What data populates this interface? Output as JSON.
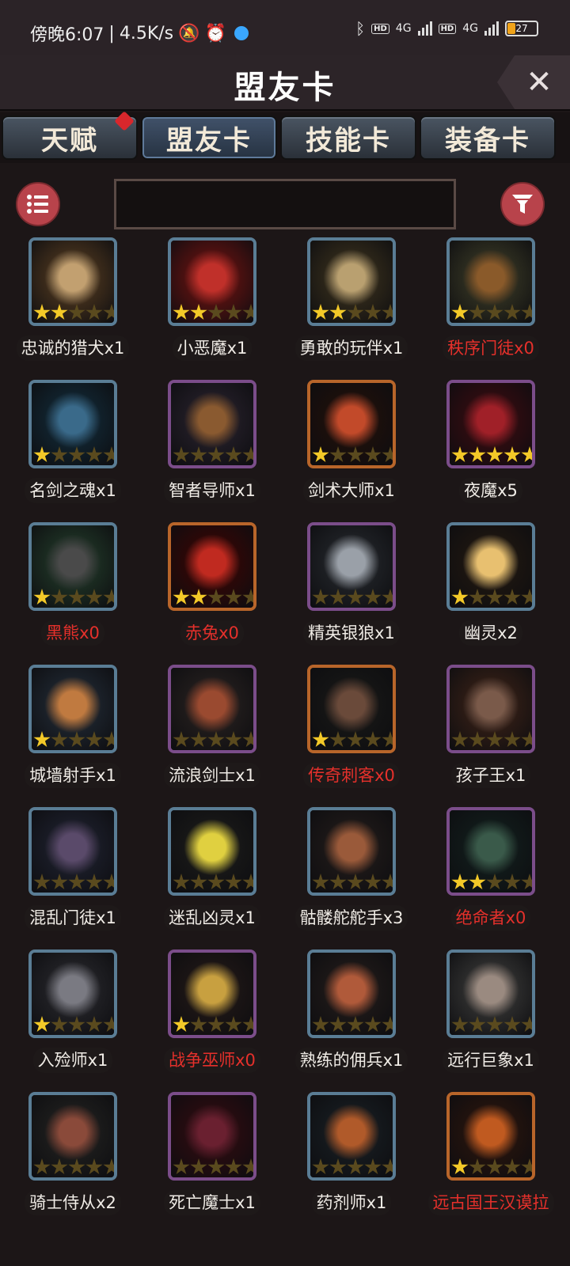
{
  "status_bar": {
    "time": "傍晚6:07",
    "speed": "4.5K/s",
    "network_1": "4G",
    "network_2": "4G",
    "hd_1": "HD",
    "hd_2": "HD",
    "battery": "27"
  },
  "header": {
    "title": "盟友卡",
    "close_label": "✕"
  },
  "tabs": [
    {
      "label": "天赋",
      "badge": true
    },
    {
      "label": "盟友卡",
      "active": true
    },
    {
      "label": "技能卡"
    },
    {
      "label": "装备卡"
    }
  ],
  "search": {
    "value": ""
  },
  "icons": {
    "menu": "list-icon",
    "filter": "filter-icon",
    "close": "close-icon"
  },
  "cards": [
    {
      "name": "忠诚的猎犬x1",
      "stars": 2,
      "owned": true,
      "frame": "blue"
    },
    {
      "name": "小恶魔x1",
      "stars": 2,
      "owned": true,
      "frame": "blue"
    },
    {
      "name": "勇敢的玩伴x1",
      "stars": 2,
      "owned": true,
      "frame": "blue"
    },
    {
      "name": "秩序门徒x0",
      "stars": 1,
      "owned": false,
      "frame": "blue"
    },
    {
      "name": "名剑之魂x1",
      "stars": 1,
      "owned": true,
      "frame": "blue"
    },
    {
      "name": "智者导师x1",
      "stars": 0,
      "owned": true,
      "frame": "purple"
    },
    {
      "name": "剑术大师x1",
      "stars": 1,
      "owned": true,
      "frame": "orange"
    },
    {
      "name": "夜魔x5",
      "stars": 5,
      "owned": true,
      "frame": "purple"
    },
    {
      "name": "黑熊x0",
      "stars": 1,
      "owned": false,
      "frame": "blue"
    },
    {
      "name": "赤兔x0",
      "stars": 2,
      "owned": false,
      "frame": "orange"
    },
    {
      "name": "精英银狼x1",
      "stars": 0,
      "owned": true,
      "frame": "purple"
    },
    {
      "name": "幽灵x2",
      "stars": 1,
      "owned": true,
      "frame": "blue"
    },
    {
      "name": "城墙射手x1",
      "stars": 1,
      "owned": true,
      "frame": "blue"
    },
    {
      "name": "流浪剑士x1",
      "stars": 0,
      "owned": true,
      "frame": "purple"
    },
    {
      "name": "传奇刺客x0",
      "stars": 1,
      "owned": false,
      "frame": "orange"
    },
    {
      "name": "孩子王x1",
      "stars": 0,
      "owned": true,
      "frame": "purple"
    },
    {
      "name": "混乱门徒x1",
      "stars": 0,
      "owned": true,
      "frame": "blue"
    },
    {
      "name": "迷乱凶灵x1",
      "stars": 0,
      "owned": true,
      "frame": "blue"
    },
    {
      "name": "骷髅舵舵手x3",
      "stars": 0,
      "owned": true,
      "frame": "blue"
    },
    {
      "name": "绝命者x0",
      "stars": 2,
      "owned": false,
      "frame": "purple"
    },
    {
      "name": "入殓师x1",
      "stars": 1,
      "owned": true,
      "frame": "blue"
    },
    {
      "name": "战争巫师x0",
      "stars": 1,
      "owned": false,
      "frame": "purple"
    },
    {
      "name": "熟练的佣兵x1",
      "stars": 0,
      "owned": true,
      "frame": "blue"
    },
    {
      "name": "远行巨象x1",
      "stars": 0,
      "owned": true,
      "frame": "blue"
    },
    {
      "name": "骑士侍从x2",
      "stars": 0,
      "owned": true,
      "frame": "blue"
    },
    {
      "name": "死亡魔士x1",
      "stars": 0,
      "owned": true,
      "frame": "purple"
    },
    {
      "name": "药剂师x1",
      "stars": 0,
      "owned": true,
      "frame": "blue"
    },
    {
      "name": "远古国王汉谟拉",
      "stars": 1,
      "owned": false,
      "frame": "orange"
    }
  ],
  "palette": {
    "owned_text": "#f0ece6",
    "missing_text": "#e5302b",
    "star_on": "#f3c928",
    "star_off": "#5a4a1e"
  }
}
